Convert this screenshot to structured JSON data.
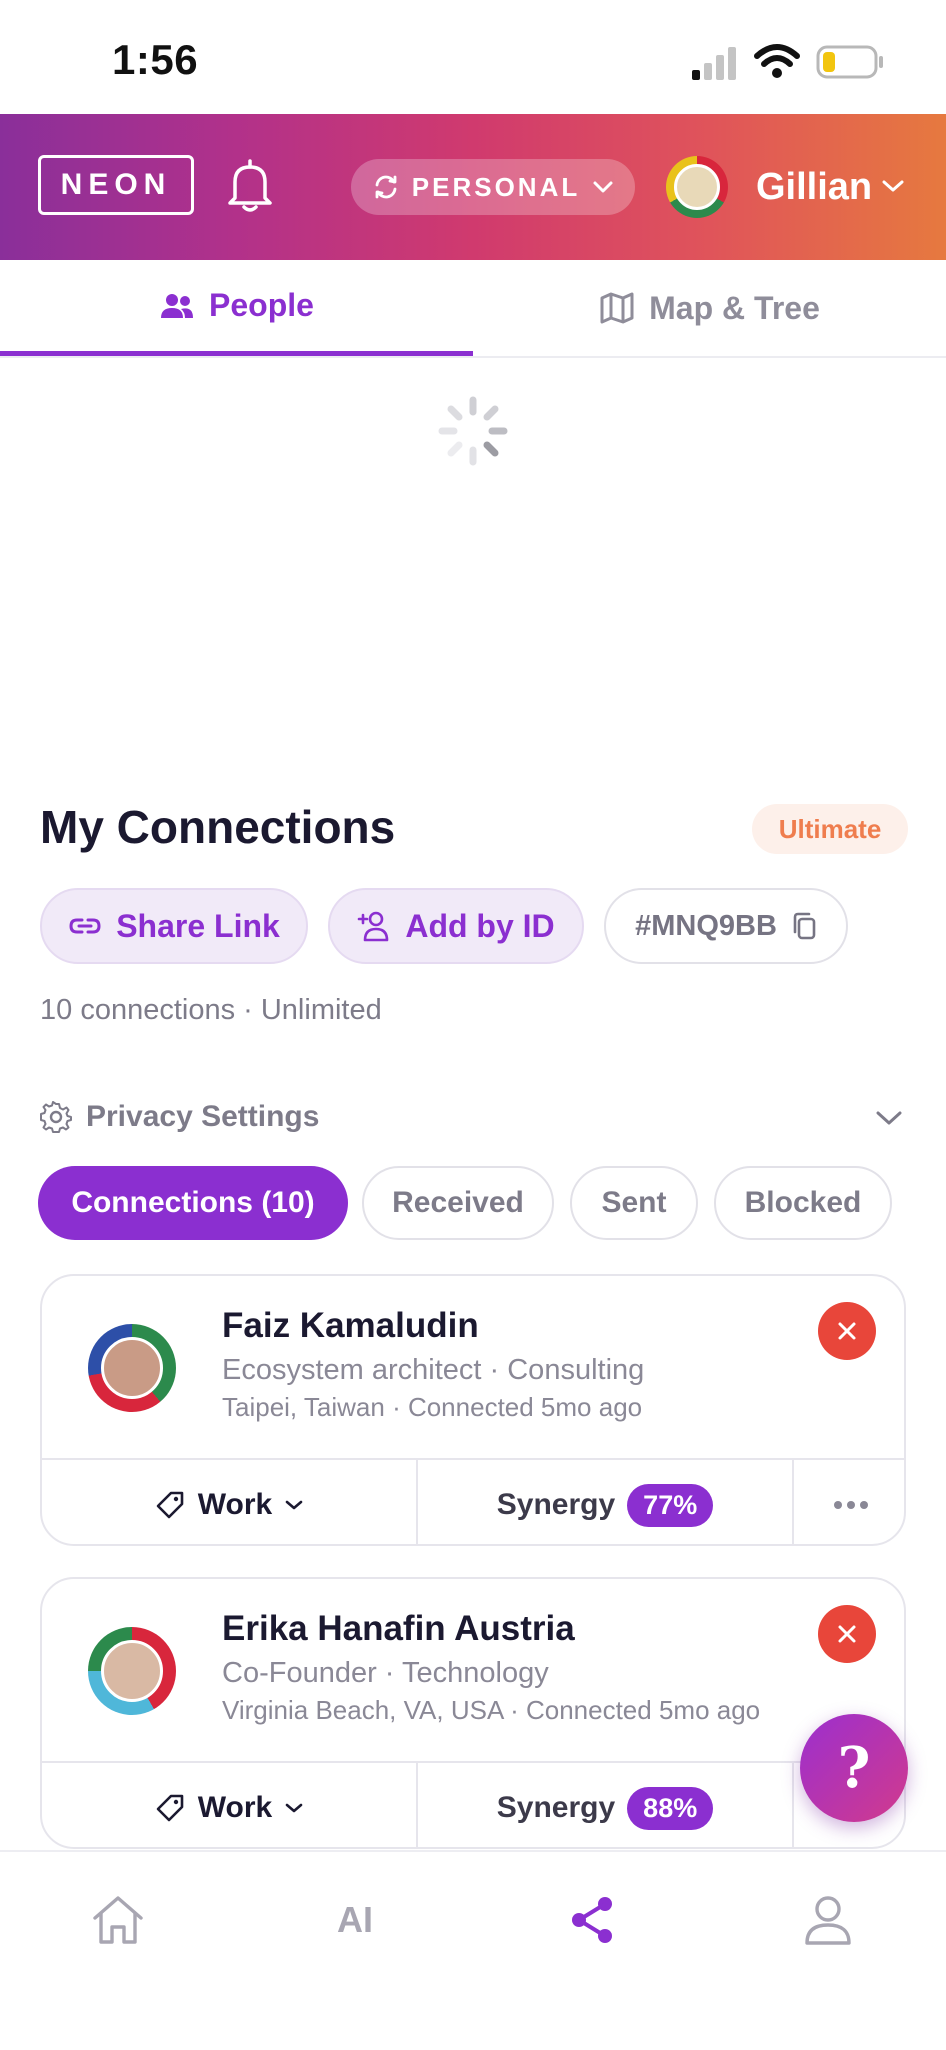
{
  "status_bar": {
    "time": "1:56"
  },
  "header": {
    "logo": "NEON",
    "mode": "PERSONAL",
    "user_name": "Gillian"
  },
  "tabs": [
    {
      "label": "People",
      "active": true
    },
    {
      "label": "Map & Tree",
      "active": false
    }
  ],
  "connections": {
    "title": "My Connections",
    "plan": "Ultimate",
    "share_link": "Share Link",
    "add_by_id": "Add by ID",
    "user_id": "#MNQ9BB",
    "count_text": "10 connections · Unlimited",
    "privacy_label": "Privacy Settings",
    "filters": [
      {
        "label": "Connections (10)",
        "active": true
      },
      {
        "label": "Received",
        "active": false
      },
      {
        "label": "Sent",
        "active": false
      },
      {
        "label": "Blocked",
        "active": false
      }
    ],
    "items": [
      {
        "name": "Faiz Kamaludin",
        "role": "Ecosystem architect  · Consulting",
        "location": "Taipei, Taiwan · Connected 5mo ago",
        "tag": "Work",
        "synergy_label": "Synergy",
        "synergy": "77%"
      },
      {
        "name": "Erika Hanafin Austria",
        "role": "Co-Founder · Technology",
        "location": "Virginia Beach, VA, USA · Connected 5mo ago",
        "tag": "Work",
        "synergy_label": "Synergy",
        "synergy": "88%"
      }
    ]
  },
  "help_fab": "?",
  "bottom_nav": {
    "ai_label": "AI",
    "active": "connections"
  },
  "colors": {
    "accent": "#8b2fd0",
    "danger": "#e8463a",
    "plan_badge": "#ef7d4e"
  }
}
